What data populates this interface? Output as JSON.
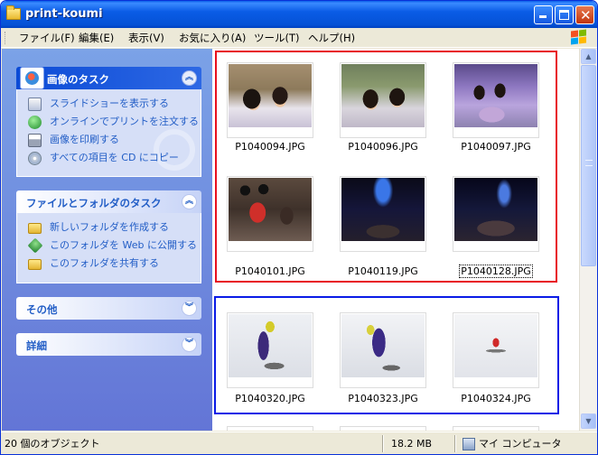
{
  "window": {
    "title": "print-koumi"
  },
  "menu": [
    {
      "label": "ファイル(F)"
    },
    {
      "label": "編集(E)"
    },
    {
      "label": "表示(V)"
    },
    {
      "label": "お気に入り(A)"
    },
    {
      "label": "ツール(T)"
    },
    {
      "label": "ヘルプ(H)"
    }
  ],
  "sidebar": {
    "image_tasks": {
      "title": "画像のタスク",
      "items": [
        {
          "label": "スライドショーを表示する",
          "icon": "slideshow-icon"
        },
        {
          "label": "オンラインでプリントを注文する",
          "icon": "online-print-icon"
        },
        {
          "label": "画像を印刷する",
          "icon": "printer-icon"
        },
        {
          "label": "すべての項目を CD にコピー",
          "icon": "cd-copy-icon"
        }
      ]
    },
    "file_folder_tasks": {
      "title": "ファイルとフォルダのタスク",
      "items": [
        {
          "label": "新しいフォルダを作成する",
          "icon": "new-folder-icon"
        },
        {
          "label": "このフォルダを Web に公開する",
          "icon": "web-publish-icon"
        },
        {
          "label": "このフォルダを共有する",
          "icon": "share-folder-icon"
        }
      ]
    },
    "other": {
      "title": "その他"
    },
    "details": {
      "title": "詳細"
    }
  },
  "files": [
    {
      "name": "P1040094.JPG",
      "selected": false
    },
    {
      "name": "P1040096.JPG",
      "selected": false
    },
    {
      "name": "P1040097.JPG",
      "selected": false
    },
    {
      "name": "P1040101.JPG",
      "selected": false
    },
    {
      "name": "P1040119.JPG",
      "selected": false
    },
    {
      "name": "P1040128.JPG",
      "selected": true
    },
    {
      "name": "P1040320.JPG",
      "selected": false
    },
    {
      "name": "P1040323.JPG",
      "selected": false
    },
    {
      "name": "P1040324.JPG",
      "selected": false
    }
  ],
  "status": {
    "object_count": "20 個のオブジェクト",
    "size": "18.2 MB",
    "location": "マイ コンピュータ"
  },
  "colors": {
    "title_bar": "#0a5ce6",
    "sidebar": "#6d8cde",
    "group_red": "#e8101f",
    "group_blue": "#0a1be6"
  }
}
